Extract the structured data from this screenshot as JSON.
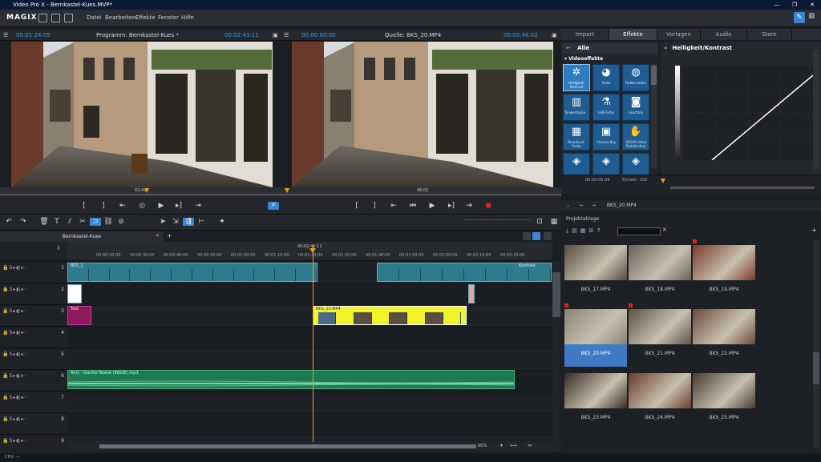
{
  "window": {
    "title": "Video Pro X - Bernkastel-Kues.MVP*",
    "controls": [
      "—",
      "❐",
      "✕"
    ]
  },
  "app": {
    "logo": "MAGIX"
  },
  "menu": [
    "Datei",
    "Bearbeiten",
    "Effekte",
    "Fenster",
    "Hilfe"
  ],
  "program_monitor": {
    "time_left": "00:01:24:05",
    "title": "Programm: Bernkastel-Kues *",
    "time_right": "00:02:43:11",
    "marker_time": "02:42"
  },
  "source_monitor": {
    "time_left": "00:00:00:00",
    "title": "Quelle: BKS_20.MP4",
    "time_right": "00:00:46:02",
    "marker_time": "46:02"
  },
  "tabs": [
    "Import",
    "Effekte",
    "Vorlagen",
    "Audio",
    "Store"
  ],
  "effects": {
    "breadcrumb": "Alle",
    "category": "Videoeffekte",
    "items": [
      {
        "label": "Helligkeit/ Kontrast",
        "icon": "✲"
      },
      {
        "label": "Farbe",
        "icon": "◕"
      },
      {
        "label": "Farbkorrektur",
        "icon": "◍"
      },
      {
        "label": "Tonwertkorre...",
        "icon": "▥"
      },
      {
        "label": "LAB-Farbe",
        "icon": "⚗"
      },
      {
        "label": "Leuchten",
        "icon": "◙"
      },
      {
        "label": "Broadcast-Farbe",
        "icon": "▦"
      },
      {
        "label": "Chroma Key",
        "icon": "▣"
      },
      {
        "label": "VEGAS Video Stabilisation",
        "icon": "✋"
      },
      {
        "label": "",
        "icon": "◈"
      },
      {
        "label": "",
        "icon": "◈"
      },
      {
        "label": "",
        "icon": "◈"
      }
    ]
  },
  "effect_detail": {
    "title": "Helligkeit/Kontrast",
    "time": "00:00:05:09",
    "unit_label": "Einheit:",
    "unit_value": "100"
  },
  "source_path": "BKS_20.MP4",
  "project": {
    "title": "Projektablage",
    "items": [
      {
        "name": "BKS_17.MP4",
        "selected": false,
        "marked": false
      },
      {
        "name": "BKS_18.MP4",
        "selected": false,
        "marked": false
      },
      {
        "name": "BKS_19.MP4",
        "selected": false,
        "marked": true
      },
      {
        "name": "BKS_20.MP4",
        "selected": true,
        "marked": true
      },
      {
        "name": "BKS_21.MP4",
        "selected": false,
        "marked": true
      },
      {
        "name": "BKS_22.MP4",
        "selected": false,
        "marked": false
      },
      {
        "name": "BKS_23.MP4",
        "selected": false,
        "marked": false
      },
      {
        "name": "BKS_24.MP4",
        "selected": false,
        "marked": false
      },
      {
        "name": "BKS_25.MP4",
        "selected": false,
        "marked": false
      }
    ]
  },
  "timeline": {
    "tab": "Bernkastel-Kues",
    "playhead_time": "00:02:42:11",
    "ruler_ticks": [
      "00:00:20:00",
      "00:00:30:00",
      "00:00:40:00",
      "00:00:50:00",
      "00:01:00:00",
      "00:01:10:00",
      "00:01:20:00",
      "00:01:30:00",
      "00:01:40:00",
      "00:01:50:00",
      "00:02:00:00",
      "00:02:10:00",
      "00:02:20:00"
    ],
    "tracks": [
      "1",
      "2",
      "3",
      "4",
      "5",
      "6",
      "7",
      "8",
      "9"
    ],
    "clip_yellow": "BKS_20.MP4",
    "clip_audio": "Amy - Dankle Nuese (INGSE).mp3",
    "clip_title": "Text",
    "clip_end": "Kontrast",
    "zoom": "90%"
  },
  "status": {
    "cpu": "CPU: —"
  }
}
